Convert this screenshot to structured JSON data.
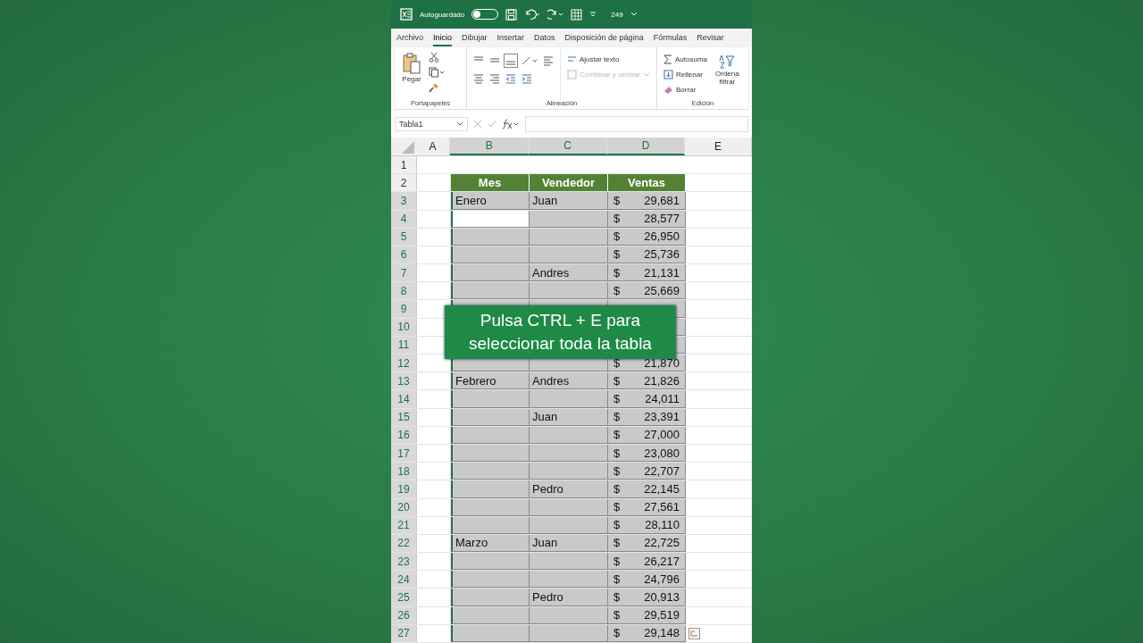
{
  "title_bar": {
    "autosave_label": "Autoguardado",
    "autosave_on": false,
    "file_name": "249"
  },
  "tabs": [
    {
      "label": "Archivo",
      "selected": false
    },
    {
      "label": "Inicio",
      "selected": true
    },
    {
      "label": "Dibujar",
      "selected": false
    },
    {
      "label": "Insertar",
      "selected": false
    },
    {
      "label": "Datos",
      "selected": false
    },
    {
      "label": "Disposición de página",
      "selected": false
    },
    {
      "label": "Fórmulas",
      "selected": false
    },
    {
      "label": "Revisar",
      "selected": false
    }
  ],
  "ribbon": {
    "clipboard": {
      "paste": "Pegar",
      "group": "Portapapeles"
    },
    "alignment": {
      "wrap": "Ajustar texto",
      "merge": "Combinar y centrar",
      "merge_disabled": true,
      "group": "Alineación"
    },
    "editing": {
      "autosum": "Autosuma",
      "fill": "Rellenar",
      "clear": "Borrar",
      "sort_1": "Ordena",
      "sort_2": "filtrar",
      "group": "Edición"
    }
  },
  "name_box": "Tabla1",
  "columns": [
    "A",
    "B",
    "C",
    "D",
    "E"
  ],
  "top_rows": [
    "1",
    "2"
  ],
  "table": {
    "headers": [
      "Mes",
      "Vendedor",
      "Ventas"
    ],
    "rows": [
      {
        "n": "3",
        "mes": "Enero",
        "vendedor": "Juan",
        "currency": "$",
        "ventas": "29,681",
        "selected": true
      },
      {
        "n": "4",
        "currency": "$",
        "ventas": "28,577",
        "active": true,
        "selected": true
      },
      {
        "n": "5",
        "currency": "$",
        "ventas": "26,950",
        "selected": true
      },
      {
        "n": "6",
        "currency": "$",
        "ventas": "25,736",
        "selected": true
      },
      {
        "n": "7",
        "vendedor": "Andres",
        "currency": "$",
        "ventas": "21,131",
        "selected": true
      },
      {
        "n": "8",
        "currency": "$",
        "ventas": "25,669",
        "selected": true
      },
      {
        "n": "9",
        "selected": true
      },
      {
        "n": "10",
        "selected": true
      },
      {
        "n": "11",
        "selected": true
      },
      {
        "n": "12",
        "currency": "$",
        "ventas": "21,870",
        "selected": true
      },
      {
        "n": "13",
        "mes": "Febrero",
        "vendedor": "Andres",
        "currency": "$",
        "ventas": "21,826",
        "selected": true
      },
      {
        "n": "14",
        "currency": "$",
        "ventas": "24,011",
        "selected": true
      },
      {
        "n": "15",
        "vendedor": "Juan",
        "currency": "$",
        "ventas": "23,391",
        "selected": true
      },
      {
        "n": "16",
        "currency": "$",
        "ventas": "27,000",
        "selected": true
      },
      {
        "n": "17",
        "currency": "$",
        "ventas": "23,080",
        "selected": true
      },
      {
        "n": "18",
        "currency": "$",
        "ventas": "22,707",
        "selected": true
      },
      {
        "n": "19",
        "vendedor": "Pedro",
        "currency": "$",
        "ventas": "22,145",
        "selected": true
      },
      {
        "n": "20",
        "currency": "$",
        "ventas": "27,561",
        "selected": true
      },
      {
        "n": "21",
        "currency": "$",
        "ventas": "28,110",
        "selected": true
      },
      {
        "n": "22",
        "mes": "Marzo",
        "vendedor": "Juan",
        "currency": "$",
        "ventas": "22,725",
        "selected": true
      },
      {
        "n": "23",
        "currency": "$",
        "ventas": "26,217",
        "selected": true
      },
      {
        "n": "24",
        "currency": "$",
        "ventas": "24,796",
        "selected": true
      },
      {
        "n": "25",
        "vendedor": "Pedro",
        "currency": "$",
        "ventas": "20,913",
        "selected": true
      },
      {
        "n": "26",
        "currency": "$",
        "ventas": "29,519",
        "selected": true
      },
      {
        "n": "27",
        "currency": "$",
        "ventas": "29,148",
        "selected": true
      }
    ]
  },
  "caption": "Pulsa CTRL + E para seleccionar toda la tabla"
}
